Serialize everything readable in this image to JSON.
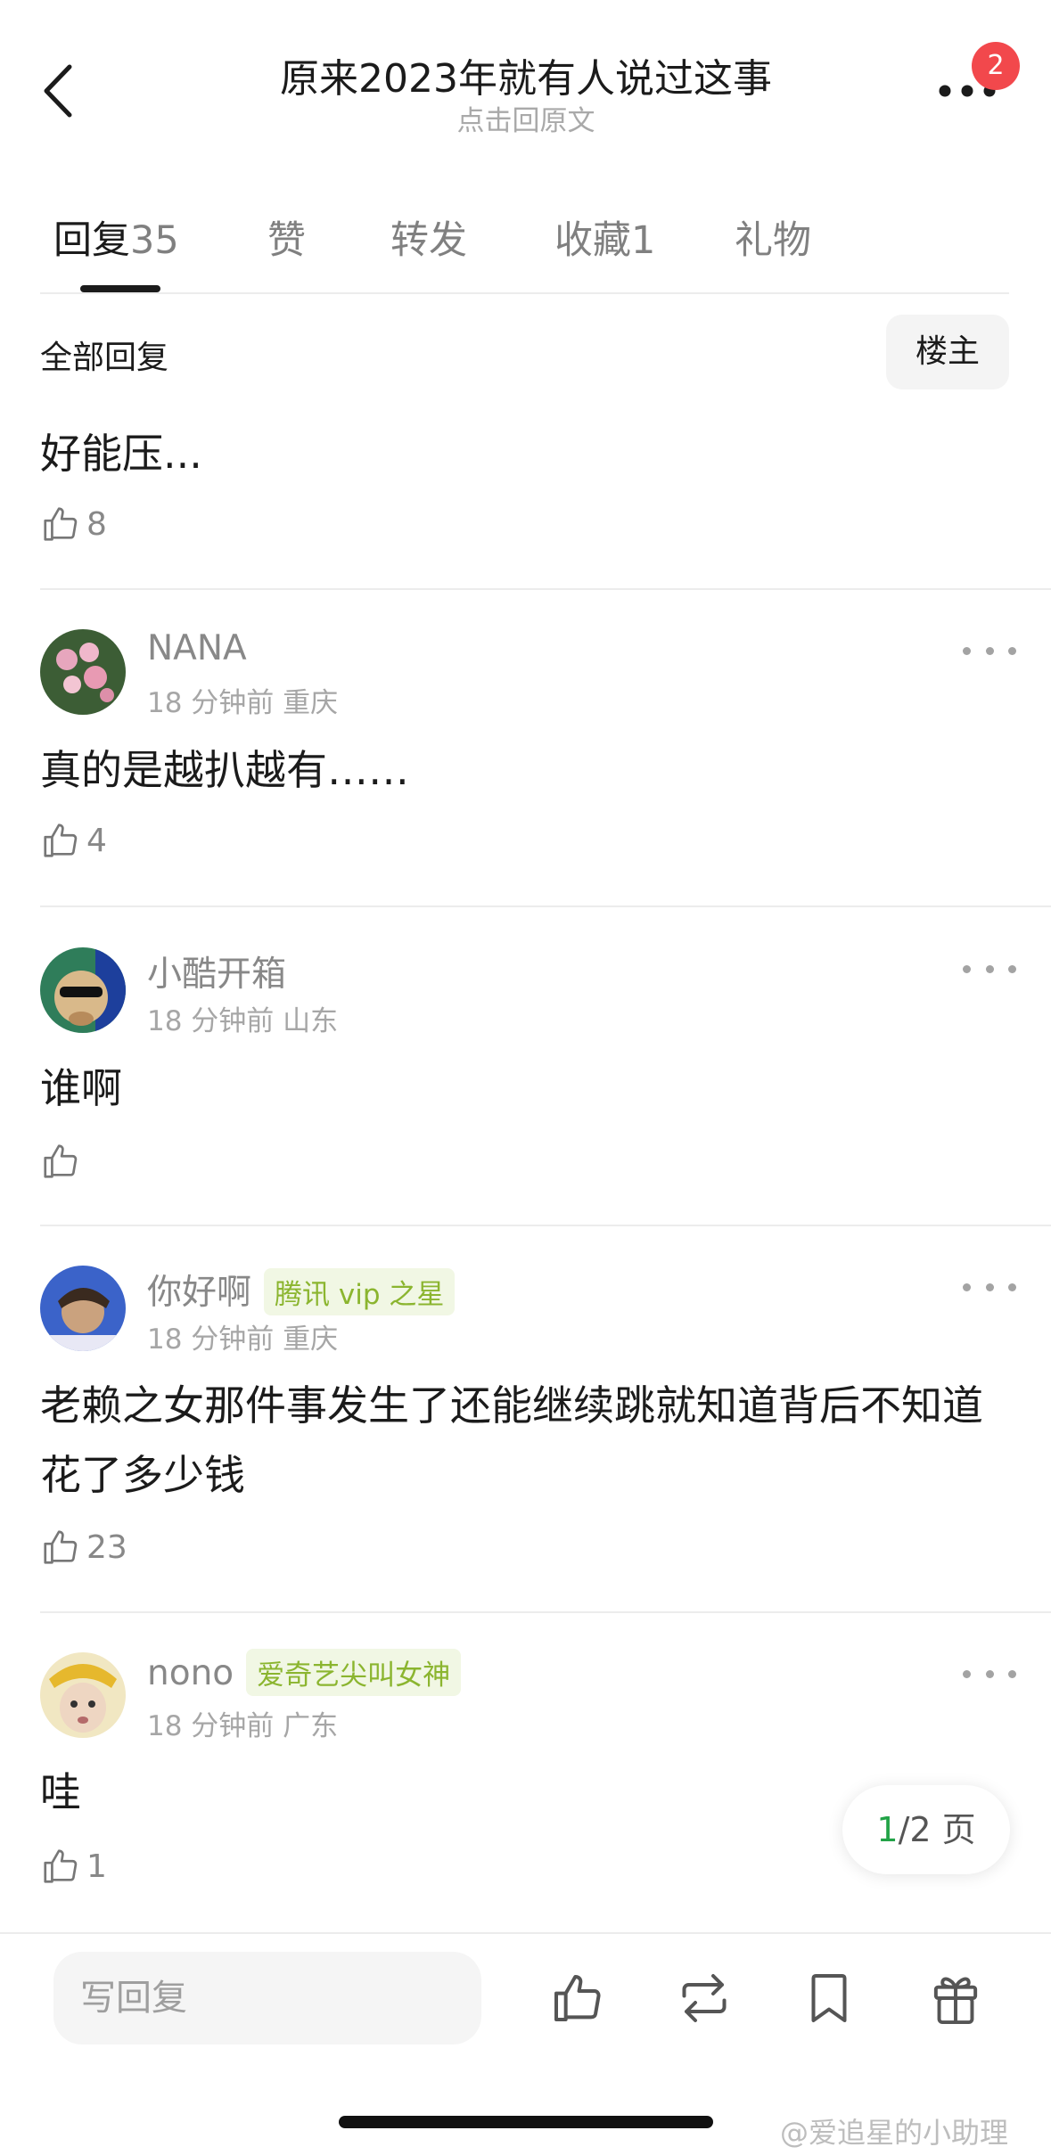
{
  "header": {
    "title": "原来2023年就有人说过这事",
    "subtitle": "点击回原文",
    "notification_count": "2"
  },
  "tabs": [
    {
      "label": "回复",
      "count": "35"
    },
    {
      "label": "赞",
      "count": ""
    },
    {
      "label": "转发",
      "count": ""
    },
    {
      "label": "收藏",
      "count": "1"
    },
    {
      "label": "礼物",
      "count": ""
    }
  ],
  "filter": {
    "all_replies": "全部回复",
    "op_only": "楼主"
  },
  "comments": [
    {
      "text": "好能压...",
      "likes": "8"
    },
    {
      "user": "NANA",
      "time": "18 分钟前",
      "location": "重庆",
      "text": "真的是越扒越有……",
      "likes": "4"
    },
    {
      "user": "小酷开箱",
      "time": "18 分钟前",
      "location": "山东",
      "text": "谁啊",
      "likes": ""
    },
    {
      "user": "你好啊",
      "tag": "腾讯 vip 之星",
      "time": "18 分钟前",
      "location": "重庆",
      "text": "老赖之女那件事发生了还能继续跳就知道背后不知道花了多少钱",
      "likes": "23"
    },
    {
      "user": "nono",
      "tag": "爱奇艺尖叫女神",
      "time": "18 分钟前",
      "location": "广东",
      "text": "哇",
      "likes": "1"
    }
  ],
  "pagination": {
    "current": "1",
    "total": "/2 页"
  },
  "bottom_bar": {
    "reply_placeholder": "写回复",
    "icons": [
      "like-icon",
      "repost-icon",
      "bookmark-icon",
      "gift-icon"
    ]
  },
  "watermark": "@爱追星的小助理",
  "colors": {
    "accent_green": "#22a347",
    "badge_red": "#f2484c",
    "tag_green": "#8bb52f"
  }
}
